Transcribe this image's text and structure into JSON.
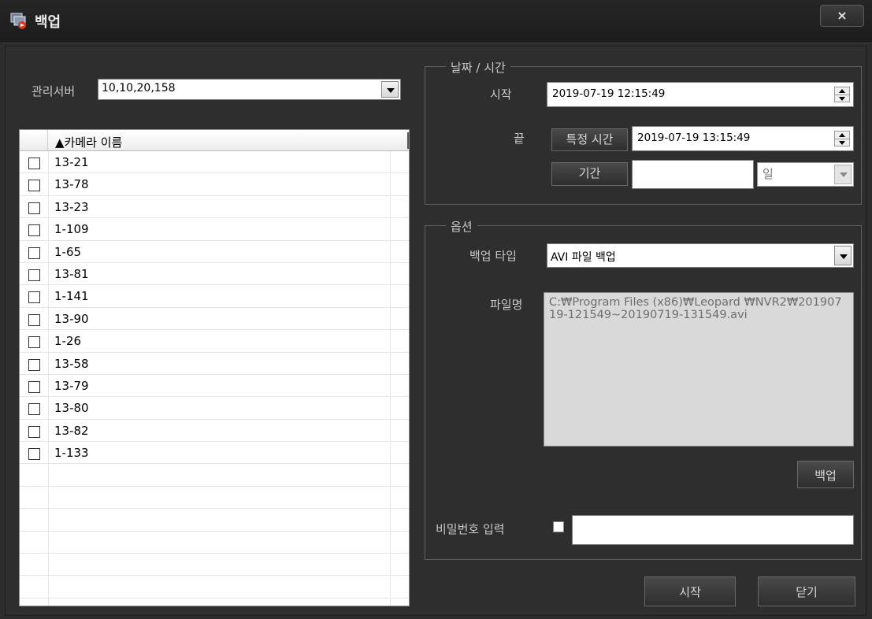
{
  "window": {
    "title": "백업",
    "close_label": "×"
  },
  "server": {
    "label": "관리서버",
    "value": "10,10,20,158"
  },
  "camera_list": {
    "header": "▲카메라 이름",
    "items": [
      "13-21",
      "13-78",
      "13-23",
      "1-109",
      "1-65",
      "13-81",
      "1-141",
      "13-90",
      "1-26",
      "13-58",
      "13-79",
      "13-80",
      "13-82",
      "1-133"
    ]
  },
  "datetime_group": {
    "title": "날짜 / 시간",
    "start_label": "시작",
    "start_value": "2019-07-19  12:15:49",
    "end_label": "끝",
    "specific_time_button": "특정 시간",
    "end_value": "2019-07-19  13:15:49",
    "period_button": "기간",
    "period_value": "",
    "period_unit": "일"
  },
  "options_group": {
    "title": "옵션",
    "backup_type_label": "백업 타입",
    "backup_type_value": "AVI 파일 백업",
    "filename_label": "파일명",
    "filename_value": "C:₩Program Files (x86)₩Leopard ₩NVR2₩20190719-121549~20190719-131549.avi",
    "backup_button": "백업",
    "password_label": "비밀번호 입력",
    "password_checked": false,
    "password_value": ""
  },
  "footer": {
    "start_button": "시작",
    "close_button": "닫기"
  },
  "colors": {
    "background": "#2e2e2e",
    "titlebar": "#1e1e1e",
    "button": "#3a3a3a",
    "text": "#c8c8c8"
  }
}
